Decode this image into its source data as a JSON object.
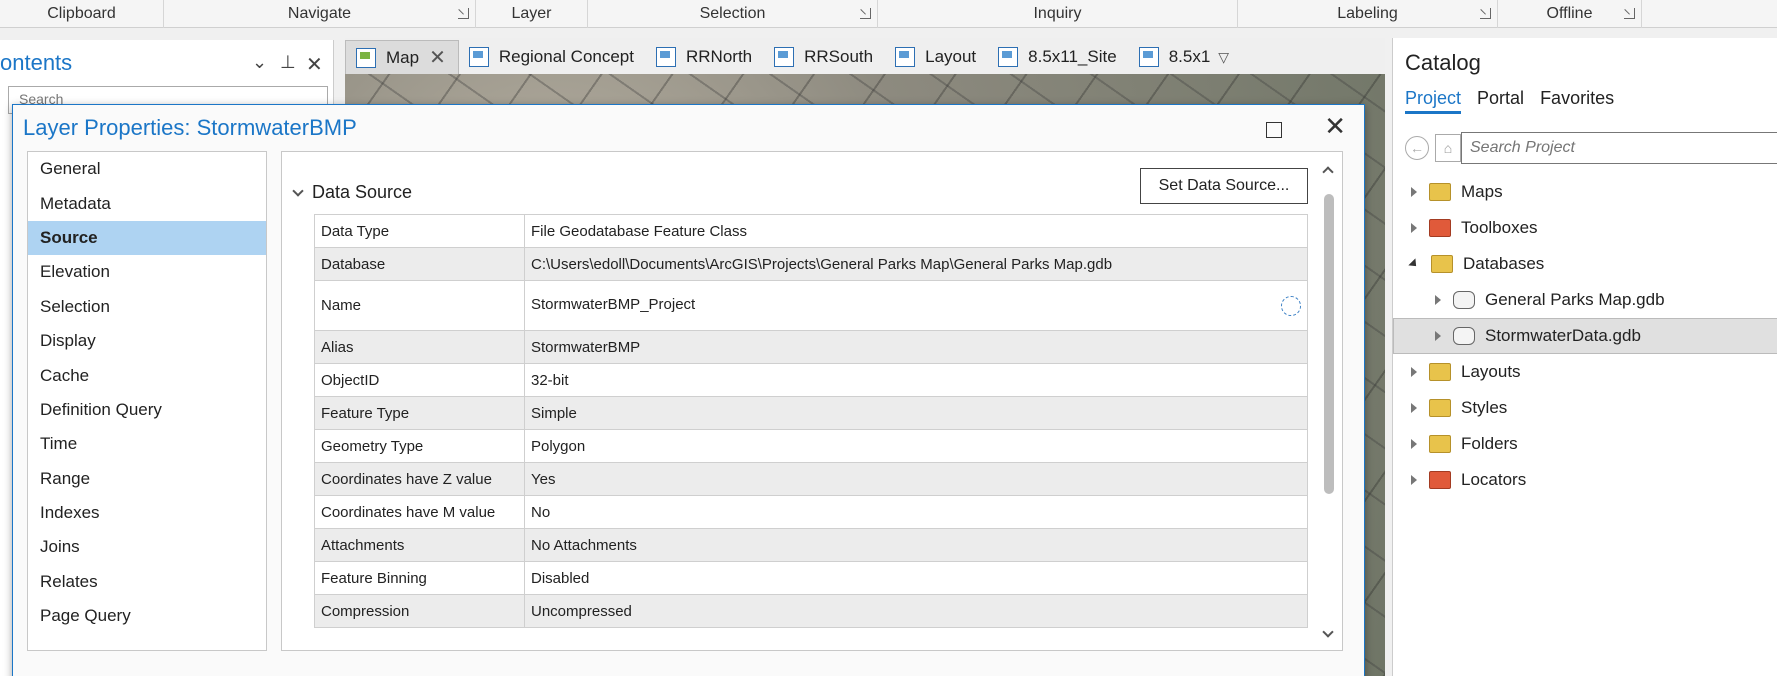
{
  "ribbon": {
    "groups": [
      {
        "label": "Clipboard",
        "launcher": false
      },
      {
        "label": "Navigate",
        "launcher": true
      },
      {
        "label": "Layer",
        "launcher": false
      },
      {
        "label": "Selection",
        "launcher": true
      },
      {
        "label": "Inquiry",
        "launcher": false
      },
      {
        "label": "Labeling",
        "launcher": true
      },
      {
        "label": "Offline",
        "launcher": true
      }
    ]
  },
  "contents": {
    "title": "ontents",
    "search_placeholder": "Search"
  },
  "doc_tabs": [
    {
      "label": "Map",
      "active": true
    },
    {
      "label": "Regional Concept"
    },
    {
      "label": "RRNorth"
    },
    {
      "label": "RRSouth"
    },
    {
      "label": "Layout"
    },
    {
      "label": "8.5x11_Site"
    },
    {
      "label": "8.5x1"
    }
  ],
  "dialog": {
    "title": "Layer Properties: StormwaterBMP",
    "nav": [
      "General",
      "Metadata",
      "Source",
      "Elevation",
      "Selection",
      "Display",
      "Cache",
      "Definition Query",
      "Time",
      "Range",
      "Indexes",
      "Joins",
      "Relates",
      "Page Query"
    ],
    "selected_nav": "Source",
    "section_title": "Data Source",
    "set_source_button": "Set Data Source...",
    "properties": [
      {
        "key": "Data Type",
        "value": "File Geodatabase Feature Class"
      },
      {
        "key": "Database",
        "value": "C:\\Users\\edoll\\Documents\\ArcGIS\\Projects\\General Parks Map\\General Parks Map.gdb"
      },
      {
        "key": "Name",
        "value": "StormwaterBMP_Project"
      },
      {
        "key": "Alias",
        "value": "StormwaterBMP"
      },
      {
        "key": "ObjectID",
        "value": "32-bit"
      },
      {
        "key": "Feature Type",
        "value": "Simple"
      },
      {
        "key": "Geometry Type",
        "value": "Polygon"
      },
      {
        "key": "Coordinates have Z value",
        "value": "Yes"
      },
      {
        "key": "Coordinates have M value",
        "value": "No"
      },
      {
        "key": "Attachments",
        "value": "No Attachments"
      },
      {
        "key": "Feature Binning",
        "value": "Disabled"
      },
      {
        "key": "Compression",
        "value": "Uncompressed"
      }
    ]
  },
  "catalog": {
    "title": "Catalog",
    "tabs": [
      "Project",
      "Portal",
      "Favorites"
    ],
    "search_placeholder": "Search Project",
    "tree": [
      {
        "label": "Maps",
        "icon": "maps-folder-icon"
      },
      {
        "label": "Toolboxes",
        "icon": "toolbox-icon"
      },
      {
        "label": "Databases",
        "icon": "database-folder-icon",
        "expanded": true
      },
      {
        "label": "General Parks Map.gdb",
        "icon": "geodatabase-home-icon",
        "child": true
      },
      {
        "label": "StormwaterData.gdb",
        "icon": "geodatabase-icon",
        "child": true,
        "selected": true
      },
      {
        "label": "Layouts",
        "icon": "layouts-folder-icon"
      },
      {
        "label": "Styles",
        "icon": "styles-folder-icon"
      },
      {
        "label": "Folders",
        "icon": "folders-folder-icon"
      },
      {
        "label": "Locators",
        "icon": "locators-folder-icon"
      }
    ]
  },
  "colors": {
    "accent": "#1b76c7",
    "selection": "#aed3f2"
  }
}
